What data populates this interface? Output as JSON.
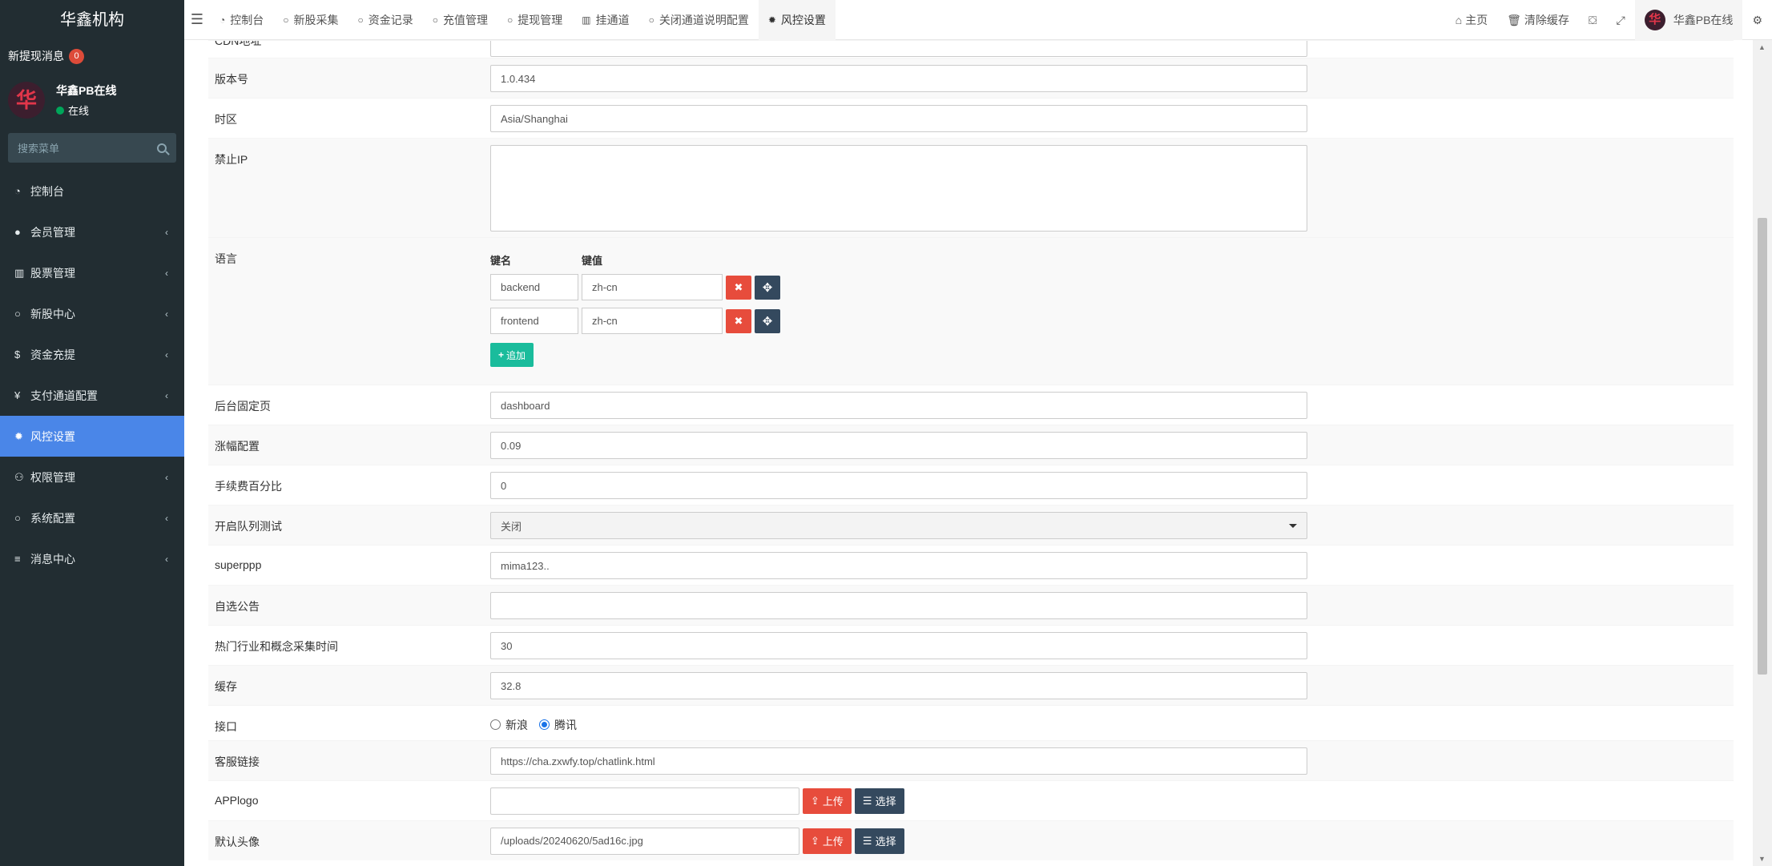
{
  "sidebar": {
    "logo": "华鑫机构",
    "notice": "新提现消息",
    "notice_count": "0",
    "user_name": "华鑫PB在线",
    "user_status": "在线",
    "avatar_glyph": "华",
    "search_placeholder": "搜索菜单",
    "items": [
      {
        "label": "控制台",
        "icon": "dashboard-icon",
        "glyph": "◔"
      },
      {
        "label": "会员管理",
        "icon": "user-circle-icon",
        "glyph": "●"
      },
      {
        "label": "股票管理",
        "icon": "bank-icon",
        "glyph": "▥"
      },
      {
        "label": "新股中心",
        "icon": "circle-outline-icon",
        "glyph": "○"
      },
      {
        "label": "资金充提",
        "icon": "dollar-icon",
        "glyph": "$"
      },
      {
        "label": "支付通道配置",
        "icon": "yen-icon",
        "glyph": "¥"
      },
      {
        "label": "风控设置",
        "icon": "gear-icon",
        "glyph": "✹"
      },
      {
        "label": "权限管理",
        "icon": "users-icon",
        "glyph": "⚇"
      },
      {
        "label": "系统配置",
        "icon": "cog-outline-icon",
        "glyph": "○"
      },
      {
        "label": "消息中心",
        "icon": "list-icon",
        "glyph": "≡"
      }
    ]
  },
  "topbar": {
    "tabs": [
      {
        "label": "控制台",
        "glyph": "◔"
      },
      {
        "label": "新股采集",
        "glyph": "○"
      },
      {
        "label": "资金记录",
        "glyph": "○"
      },
      {
        "label": "充值管理",
        "glyph": "○"
      },
      {
        "label": "提现管理",
        "glyph": "○"
      },
      {
        "label": "挂通道",
        "glyph": "▥"
      },
      {
        "label": "关闭通道说明配置",
        "glyph": "○"
      },
      {
        "label": "风控设置",
        "glyph": "✹"
      }
    ],
    "home": "主页",
    "clear_cache": "清除缓存",
    "user": "华鑫PB在线"
  },
  "form": {
    "cdn_label": "CDN地址",
    "version_label": "版本号",
    "version_value": "1.0.434",
    "timezone_label": "时区",
    "timezone_value": "Asia/Shanghai",
    "forbidip_label": "禁止IP",
    "lang_label": "语言",
    "kv_key_head": "键名",
    "kv_val_head": "键值",
    "lang_rows": [
      {
        "key": "backend",
        "value": "zh-cn"
      },
      {
        "key": "frontend",
        "value": "zh-cn"
      }
    ],
    "add_label": "追加",
    "fixedpage_label": "后台固定页",
    "fixedpage_value": "dashboard",
    "zhangfu_label": "涨幅配置",
    "zhangfu_value": "0.09",
    "fee_label": "手续费百分比",
    "fee_value": "0",
    "queue_label": "开启队列测试",
    "queue_value": "关闭",
    "superppp_label": "superppp",
    "superppp_value": "mima123..",
    "notice_label": "自选公告",
    "notice_value": "",
    "hot_label": "热门行业和概念采集时间",
    "hot_value": "30",
    "cache_label": "缓存",
    "cache_value": "32.8",
    "api_label": "接口",
    "api_opt1": "新浪",
    "api_opt2": "腾讯",
    "service_label": "客服链接",
    "service_value": "https://cha.zxwfy.top/chatlink.html",
    "applogo_label": "APPlogo",
    "applogo_value": "",
    "avatar_label": "默认头像",
    "avatar_value": "/uploads/20240620/5ad16c.jpg",
    "upload_label": "上传",
    "choose_label": "选择"
  }
}
